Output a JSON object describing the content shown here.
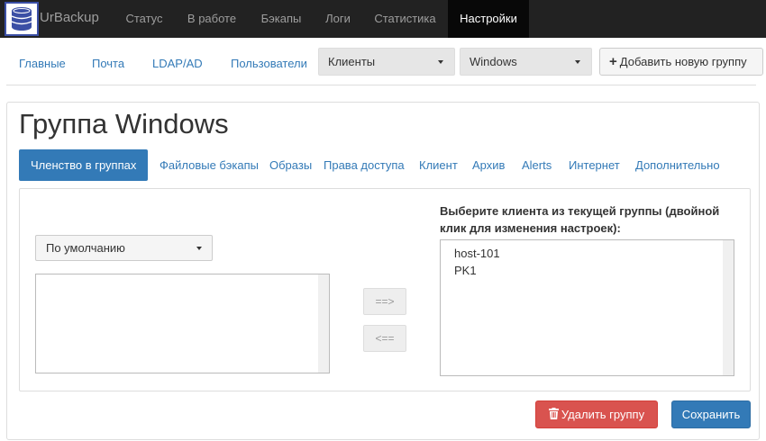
{
  "navbar": {
    "brand": "UrBackup",
    "items": [
      "Статус",
      "В работе",
      "Бэкапы",
      "Логи",
      "Статистика",
      "Настройки"
    ],
    "active": "Настройки"
  },
  "settings_nav": {
    "links": [
      "Главные",
      "Почта",
      "LDAP/AD",
      "Пользователи"
    ],
    "clients_select": "Клиенты",
    "group_select": "Windows",
    "add_group_label": "Добавить новую группу"
  },
  "group": {
    "title": "Группа Windows",
    "tabs": [
      "Членство в группах",
      "Файловые бэкапы",
      "Образы",
      "Права доступа",
      "Клиент",
      "Архив",
      "Alerts",
      "Интернет",
      "Дополнительно"
    ],
    "active_tab": "Членство в группах"
  },
  "membership": {
    "source_group": "По умолчанию",
    "source_clients": [],
    "move_right": "==>",
    "move_left": "<==",
    "current_label": "Выберите клиента из текущей группы (двойной клик для изменения настроек):",
    "current_clients": [
      "host-101",
      "PK1"
    ]
  },
  "actions": {
    "delete_label": "Удалить группу",
    "save_label": "Сохранить"
  },
  "colors": {
    "navbar_bg": "#222222",
    "link": "#337ab7",
    "primary": "#337ab7",
    "danger": "#d9534f"
  }
}
